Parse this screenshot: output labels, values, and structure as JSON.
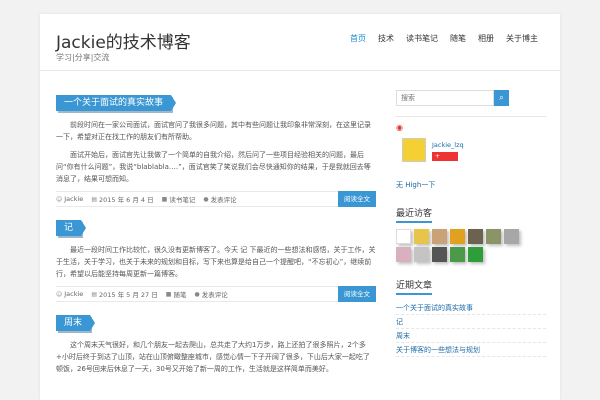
{
  "header": {
    "title": "Jackie的技术博客",
    "description": "学习|分享|交流"
  },
  "nav": {
    "items": [
      "首页",
      "技术",
      "读书笔记",
      "随笔",
      "相册",
      "关于博主"
    ]
  },
  "posts": [
    {
      "title": "一个关于面试的真实故事",
      "paragraphs": [
        "前段时间在一家公司面试，面试官问了我很多问题，其中有些问题让我印象非常深刻，在这里记录一下，希望对正在找工作的朋友们有所帮助。",
        "面试开始后，面试官先让我做了一个简单的自我介绍，然后问了一些项目经验相关的问题，最后问“你有什么问题”，我说“blablabla….”，面试官笑了笑说我们会尽快通知你的结果，于是我就回去等消息了，结果可想而知。"
      ],
      "author": "Jackie",
      "date": "2015 年 6 月 4 日",
      "category": "读书笔记",
      "comments": "发表评论",
      "read_more": "阅读全文"
    },
    {
      "title": "记",
      "paragraphs": [
        "最近一段时间工作比较忙，很久没有更新博客了。今天 记 下最近的一些想法和感悟，关于工作，关于生活，关于学习，也关于未来的规划和目标，写下来也算是给自己一个提醒吧，“不忘初心”，继续前行，希望以后能坚持每周更新一篇博客。"
      ],
      "author": "Jackie",
      "date": "2015 年 5 月 27 日",
      "category": "随笔",
      "comments": "发表评论",
      "read_more": "阅读全文"
    },
    {
      "title": "周末",
      "paragraphs": [
        "这个周末天气很好，和几个朋友一起去爬山，总共走了大约1万步，路上还拍了很多照片，2个多+小时后终于到达了山顶，站在山顶俯瞰整座城市，感觉心情一下子开阔了很多，下山后大家一起吃了顿饭，26号回来后休息了一天，30号又开始了新一周的工作，生活就是这样简单而美好。"
      ]
    }
  ],
  "sidebar": {
    "search_placeholder": "搜索",
    "weibo_name": "Jackie_lzq",
    "weibo_follow": "+",
    "high_link": "无 High一下",
    "recent_visitors_title": "最近访客",
    "recent_posts_title": "近期文章",
    "recent_posts": [
      "一个关于面试的真实故事",
      "记",
      "周末",
      "关于博客的一些想法与规划"
    ]
  },
  "colors": {
    "accent": "#3b97d3",
    "link": "#1a6aa8",
    "weibo": "#dd3333"
  }
}
